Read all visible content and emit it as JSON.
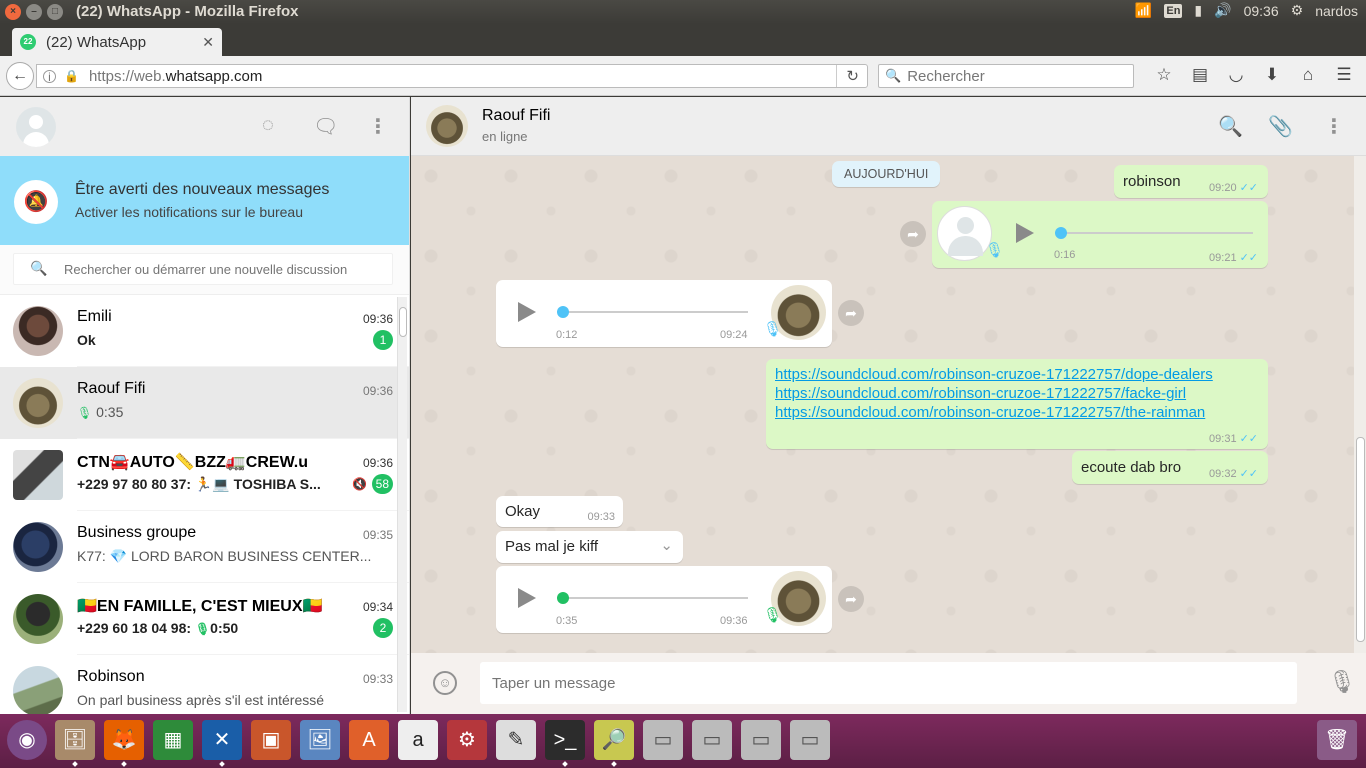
{
  "os": {
    "window_title": "(22) WhatsApp - Mozilla Firefox",
    "keyboard": "En",
    "clock": "09:36",
    "user": "nardos"
  },
  "browser": {
    "tab_title": "(22) WhatsApp",
    "tab_badge": "22",
    "url_prefix": "https://web.",
    "url_domain": "whatsapp.com",
    "search_placeholder": "Rechercher"
  },
  "sidebar": {
    "notification_title": "Être averti des nouveaux messages",
    "notification_subtitle": "Activer les notifications sur le bureau",
    "search_placeholder": "Rechercher ou démarrer une nouvelle discussion",
    "chats": [
      {
        "name": "Emili",
        "time": "09:36",
        "preview": "Ok",
        "unread": "1",
        "avatar": "photo-woman"
      },
      {
        "name": "Raouf Fifi",
        "time": "09:36",
        "preview": "0:35",
        "voice": true,
        "avatar": "group-flag-photo"
      },
      {
        "name": "CTN🚘AUTO📏BZZ🚛CREW.u",
        "time": "09:36",
        "preview": "+229 97 80 80 37: 🏃💻 TOSHIBA S...",
        "unread": "58",
        "muted": true,
        "avatar": "laptops-photo"
      },
      {
        "name": "Business groupe",
        "time": "09:35",
        "preview": "K77: 💎 LORD BARON BUSINESS CENTER...",
        "avatar": "group-photo"
      },
      {
        "name": "🇧🇯EN FAMILLE, C'EST MIEUX🇧🇯",
        "time": "09:34",
        "preview_prefix": "+229 60 18 04 98: ",
        "preview": "0:50",
        "voice": true,
        "unread": "2",
        "avatar": "man-photo"
      },
      {
        "name": "Robinson",
        "time": "09:33",
        "preview": "On parl business après s'il est intéressé",
        "avatar": "landscape-photo"
      }
    ]
  },
  "conversation": {
    "contact_name": "Raouf Fifi",
    "contact_status": "en ligne",
    "day_divider": "AUJOURD'HUI",
    "messages": [
      {
        "dir": "out",
        "type": "text",
        "text": "robinson",
        "time": "09:20"
      },
      {
        "dir": "out",
        "type": "voice",
        "duration": "0:16",
        "time": "09:21"
      },
      {
        "dir": "in",
        "type": "voice",
        "duration": "0:12",
        "time": "09:24"
      },
      {
        "dir": "out",
        "type": "links",
        "links": [
          "https://soundcloud.com/robinson-cruzoe-171222757/dope-dealers",
          "https://soundcloud.com/robinson-cruzoe-171222757/facke-girl",
          "https://soundcloud.com/robinson-cruzoe-171222757/the-rainman"
        ],
        "time": "09:31"
      },
      {
        "dir": "out",
        "type": "text",
        "text": "ecoute dab bro",
        "time": "09:32"
      },
      {
        "dir": "in",
        "type": "text",
        "text": "Okay",
        "time": "09:33"
      },
      {
        "dir": "in",
        "type": "text",
        "text": "Pas mal je kiff",
        "time": ""
      },
      {
        "dir": "in",
        "type": "voice",
        "duration": "0:35",
        "time": "09:36"
      }
    ],
    "compose_placeholder": "Taper un message"
  },
  "colors": {
    "accent_green": "#21c063",
    "outgoing_bubble": "#dcf8c6",
    "notification_banner": "#8fddfa",
    "link": "#039be5",
    "read_ticks": "#4fc3f7"
  },
  "dock": {
    "apps": [
      "ubuntu-logo",
      "files",
      "firefox",
      "libreoffice-calc",
      "vscode",
      "libreoffice-impress",
      "image-viewer",
      "software-center",
      "amazon",
      "system-settings",
      "text-editor",
      "terminal",
      "image-search",
      "drive",
      "drive",
      "drive",
      "drive",
      "trash"
    ]
  }
}
